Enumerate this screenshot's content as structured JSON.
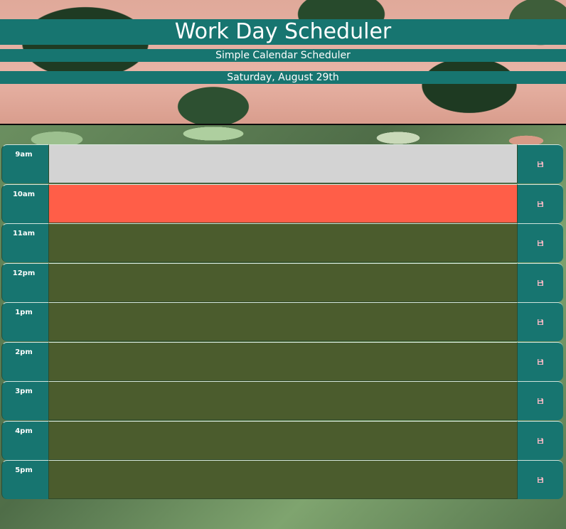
{
  "header": {
    "title": "Work Day Scheduler",
    "subtitle": "Simple Calendar Scheduler",
    "current_day": "Saturday, August 29th"
  },
  "colors": {
    "accent": "#177570",
    "past": "#d3d3d3",
    "present": "#ff5e48",
    "future": "#4b5c2d",
    "save_icon": "#f2b7c3"
  },
  "rows": [
    {
      "hour": "9am",
      "text": "",
      "state": "past"
    },
    {
      "hour": "10am",
      "text": "",
      "state": "present"
    },
    {
      "hour": "11am",
      "text": "",
      "state": "future"
    },
    {
      "hour": "12pm",
      "text": "",
      "state": "future"
    },
    {
      "hour": "1pm",
      "text": "",
      "state": "future"
    },
    {
      "hour": "2pm",
      "text": "",
      "state": "future"
    },
    {
      "hour": "3pm",
      "text": "",
      "state": "future"
    },
    {
      "hour": "4pm",
      "text": "",
      "state": "future"
    },
    {
      "hour": "5pm",
      "text": "",
      "state": "future"
    }
  ],
  "icons": {
    "save": "floppy-disk-icon"
  }
}
